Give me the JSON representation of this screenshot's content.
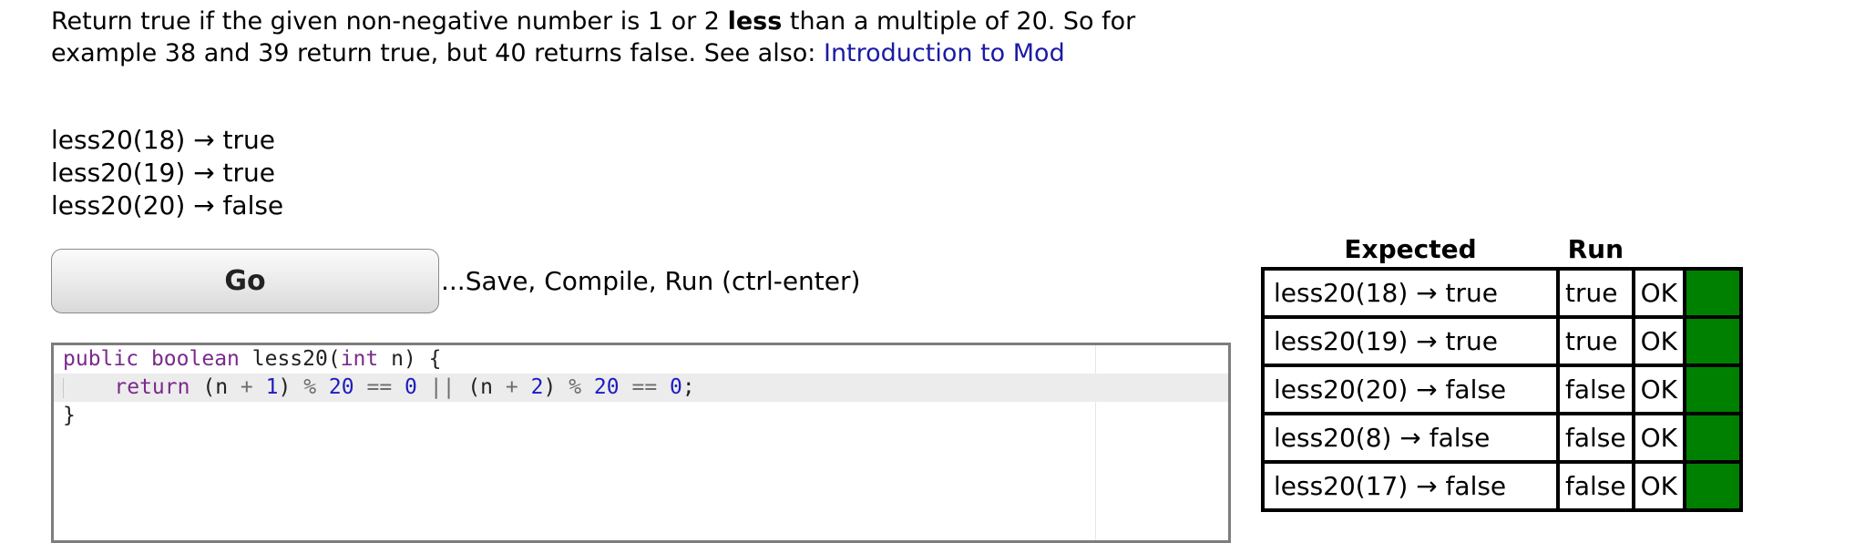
{
  "problem": {
    "part1": "Return true if the given non-negative number is 1 or 2 ",
    "part_bold": "less",
    "part2": " than a multiple of 20. So for example 38 and 39 return true, but 40 returns false. See also: ",
    "link": "Introduction to Mod"
  },
  "examples": [
    "less20(18) → true",
    "less20(19) → true",
    "less20(20) → false"
  ],
  "go_button": {
    "label": "Go",
    "hint": "...Save, Compile, Run (ctrl-enter)"
  },
  "code": {
    "line1": {
      "kw1": "public",
      "kw2": "boolean",
      "name": "less20(",
      "kw3": "int",
      "rest": "n) {"
    },
    "line2": {
      "kw": "return",
      "t1": "(n",
      "op1": "+",
      "n1": "1",
      "t2": ")",
      "op2": "%",
      "n2": "20",
      "op3": "==",
      "n3": "0",
      "op4": "||",
      "t3": "(n",
      "op5": "+",
      "n4": "2",
      "t4": ")",
      "op6": "%",
      "n5": "20",
      "op7": "==",
      "n6": "0",
      "t5": ";"
    },
    "line3": "}"
  },
  "results": {
    "headers": {
      "expected": "Expected",
      "run": "Run"
    },
    "rows": [
      {
        "expected": "less20(18) → true",
        "run": "true",
        "status": "OK"
      },
      {
        "expected": "less20(19) → true",
        "run": "true",
        "status": "OK"
      },
      {
        "expected": "less20(20) → false",
        "run": "false",
        "status": "OK"
      },
      {
        "expected": "less20(8) → false",
        "run": "false",
        "status": "OK"
      },
      {
        "expected": "less20(17) → false",
        "run": "false",
        "status": "OK"
      }
    ],
    "pass_color": "#008000"
  }
}
